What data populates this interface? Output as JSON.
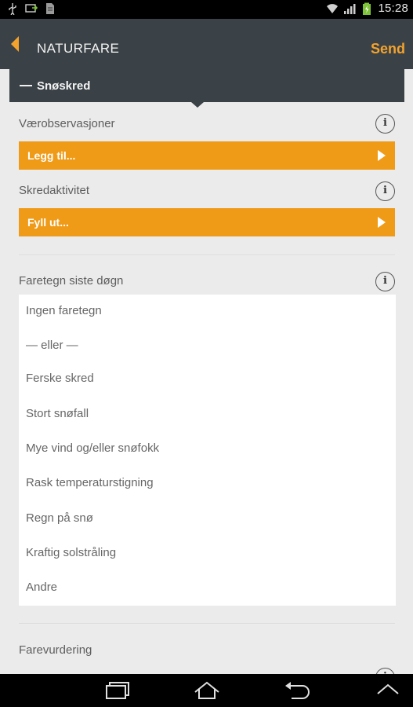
{
  "status": {
    "time": "15:28"
  },
  "header": {
    "title": "NATURFARE",
    "send_label": "Send"
  },
  "section": {
    "title": "Snøskred"
  },
  "fields": [
    {
      "label": "Værobservasjoner",
      "button": "Legg til..."
    },
    {
      "label": "Skredaktivitet",
      "button": "Fyll ut..."
    }
  ],
  "danger_signs": {
    "label": "Faretegn siste døgn",
    "options": [
      "Ingen faretegn",
      "— eller —",
      "Ferske skred",
      "Stort snøfall",
      "Mye vind og/eller snøfokk",
      "Rask temperaturstigning",
      "Regn på snø",
      "Kraftig solstråling",
      "Andre"
    ]
  },
  "assessment": {
    "label": "Farevurdering"
  },
  "info_glyph": "i",
  "colors": {
    "accent": "#ef9b18",
    "bar": "#3b4247",
    "background": "#ebebeb"
  }
}
